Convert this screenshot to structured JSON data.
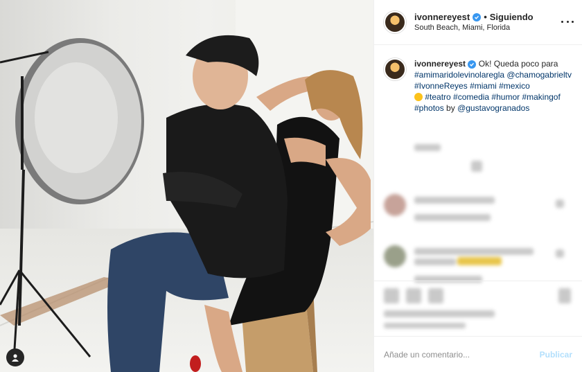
{
  "post": {
    "username": "ivonnereyest",
    "follow_status": "Siguiendo",
    "separator": "•",
    "location": "South Beach, Miami, Florida"
  },
  "caption": {
    "username": "ivonnereyest",
    "text_start": "Ok! Queda poco para",
    "tags": [
      "#amimaridolevinolaregla",
      "@chamogabrieltv",
      "#IvonneReyes",
      "#miami",
      "#mexico",
      "#teatro",
      "#comedia",
      "#humor",
      "#makingof",
      "#photos"
    ],
    "by_text": "by",
    "credit": "@gustavogranados"
  },
  "comment_box": {
    "placeholder": "Añade un comentario...",
    "publish_label": "Publicar"
  },
  "colors": {
    "verified": "#3897f0",
    "link": "#003569",
    "publish_disabled": "#b2dffc"
  },
  "icons": [
    "verified-badge-icon",
    "more-options-icon",
    "user-tag-icon",
    "like-icon",
    "comment-icon",
    "share-icon",
    "save-icon"
  ]
}
